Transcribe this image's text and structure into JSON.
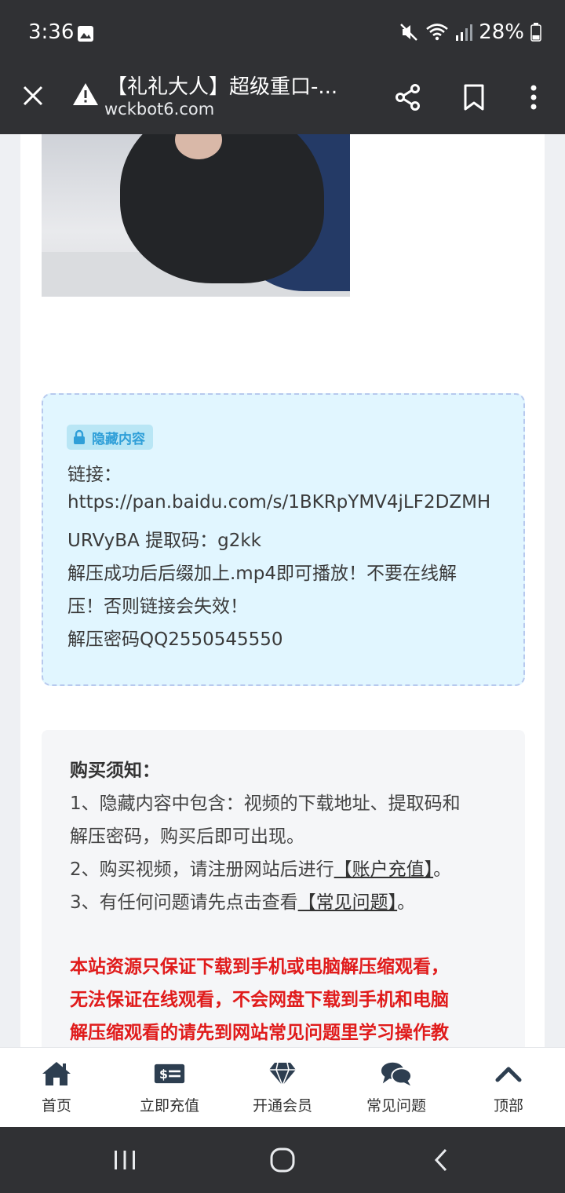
{
  "status": {
    "time": "3:36",
    "battery": "28%"
  },
  "browser": {
    "title": "【礼礼大人】超级重口-...",
    "domain": "wckbot6.com"
  },
  "hidden": {
    "badge": "隐藏内容",
    "link_label": "链接：",
    "link_line1": "https://pan.baidu.com/s/1BKRpYMV4jLF2DZMH",
    "link_line2": "URVyBA 提取码：g2kk",
    "note_line1": "解压成功后后缀加上.mp4即可播放！不要在线解",
    "note_line2": "压！否则链接会失效！",
    "password": "解压密码QQ2550545550"
  },
  "notice": {
    "title": "购买须知：",
    "item1_line1": "1、隐藏内容中包含：视频的下载地址、提取码和",
    "item1_line2": "解压密码，购买后即可出现。",
    "item2_prefix": "2、购买视频，请注册网站后进行",
    "item2_link": "【账户充值】",
    "item2_suffix": "。",
    "item3_prefix": "3、有任何问题请先点击查看",
    "item3_link": "【常见问题】",
    "item3_suffix": "。",
    "warning_line1": "本站资源只保证下载到手机或电脑解压缩观看，",
    "warning_line2": "无法保证在线观看，不会网盘下载到手机和电脑",
    "warning_line3": "解压缩观看的请先到网站常见问题里学习操作教"
  },
  "nav": {
    "items": [
      {
        "label": "首页",
        "icon": "home-icon"
      },
      {
        "label": "立即充值",
        "icon": "money-bill-icon"
      },
      {
        "label": "开通会员",
        "icon": "diamond-icon"
      },
      {
        "label": "常见问题",
        "icon": "comments-icon"
      },
      {
        "label": "顶部",
        "icon": "chevron-up-icon"
      }
    ]
  },
  "colors": {
    "system_bar": "#303134",
    "hidden_box_bg": "#e1f6ff",
    "badge_text": "#2f9fd8",
    "warning_red": "#e01b1b",
    "nav_icon": "#2d3e50"
  }
}
